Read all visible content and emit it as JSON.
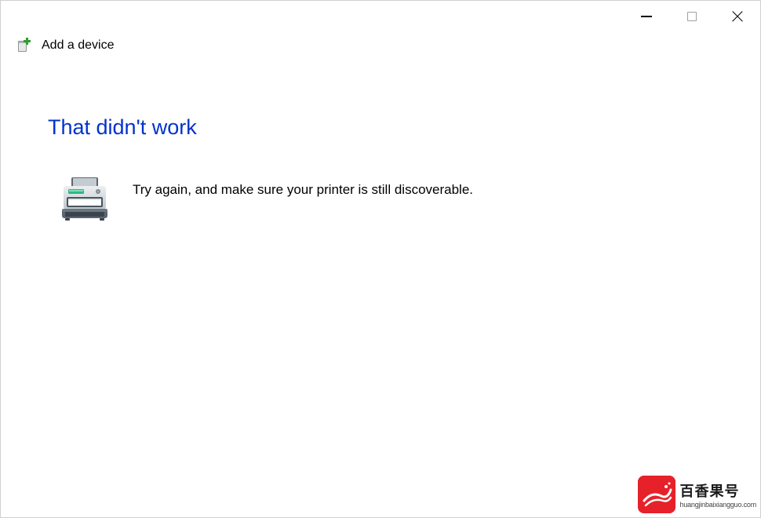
{
  "titlebar": {
    "minimize": "minimize",
    "maximize": "maximize",
    "close": "close"
  },
  "header": {
    "title": "Add a device"
  },
  "content": {
    "heading": "That didn't work",
    "message": "Try again, and make sure your printer is still discoverable."
  },
  "watermark": {
    "cn": "百香果号",
    "url": "huangjinbaixiangguo.com"
  }
}
